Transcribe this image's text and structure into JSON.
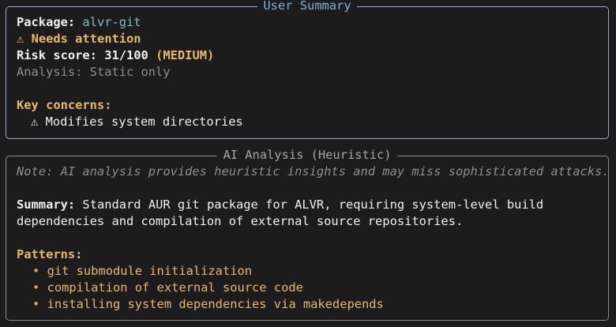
{
  "user_summary": {
    "title": "User Summary",
    "package_label": "Package:",
    "package_name": "alvr-git",
    "attention_icon": "⚠",
    "attention_text": "Needs attention",
    "risk_label": "Risk score:",
    "risk_value": "31/100",
    "risk_level": "(MEDIUM)",
    "analysis_text": "Analysis: Static only",
    "concerns_label": "Key concerns:",
    "concerns": [
      {
        "icon": "⚠",
        "text": "Modifies system directories"
      }
    ]
  },
  "ai_analysis": {
    "title": "AI Analysis (Heuristic)",
    "note": "Note: AI analysis provides heuristic insights and may miss sophisticated attacks.",
    "summary_label": "Summary:",
    "summary_line1": "Standard AUR git package for ALVR, requiring system-level build",
    "summary_line2": "dependencies and compilation of external source repositories.",
    "patterns_label": "Patterns:",
    "bullet_char": "•",
    "patterns": [
      "git submodule initialization",
      "compilation of external source code",
      "installing system dependencies via makedepends"
    ]
  },
  "colors": {
    "background": "#1c1c1c",
    "accent_cyan": "#7fb2cc",
    "warning_yellow": "#e9b86a",
    "muted_grey": "#8e8e8e"
  }
}
